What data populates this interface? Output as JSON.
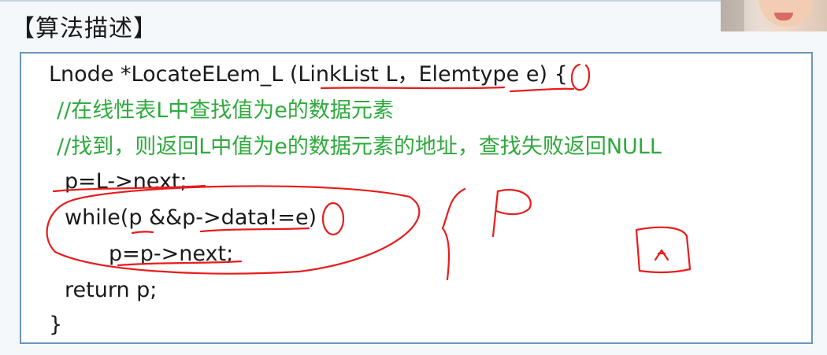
{
  "section_title": "【算法描述】",
  "code": {
    "lines": [
      {
        "text": "Lnode *LocateELem_L (LinkList L，Elemtype e) {",
        "kind": "code"
      },
      {
        "text": "//在线性表L中查找值为e的数据元素",
        "kind": "comment"
      },
      {
        "text": "//找到，则返回L中值为e的数据元素的地址，查找失败返回NULL",
        "kind": "comment"
      },
      {
        "text": "p=L->next;",
        "kind": "code"
      },
      {
        "text": "while(p &&p->data!=e)",
        "kind": "code"
      },
      {
        "text": "p=p->next;",
        "kind": "code"
      },
      {
        "text": "return p;",
        "kind": "code"
      },
      {
        "text": "}",
        "kind": "code"
      }
    ]
  },
  "colors": {
    "code_text": "#1a1a1a",
    "comment_text": "#2eaa3c",
    "box_border": "#6d94b8",
    "annotation_ink": "#e81c1c"
  }
}
